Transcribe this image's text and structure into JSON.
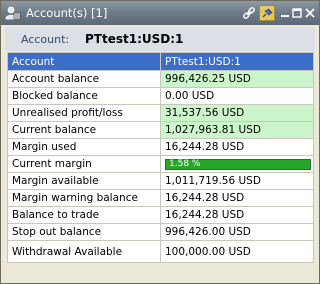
{
  "window": {
    "title": "Account(s) [1]",
    "icons": [
      "account-icon",
      "link-icon",
      "pin-icon",
      "minimize-icon",
      "maximize-icon",
      "close-icon"
    ]
  },
  "account": {
    "label": "Account:",
    "value": "PTtest1:USD:1"
  },
  "grid": {
    "header": {
      "label": "Account",
      "value": "PTtest1:USD:1"
    },
    "rows": [
      {
        "label": "Account balance",
        "value": "996,426.25 USD",
        "highlight": true
      },
      {
        "label": "Blocked balance",
        "value": "0.00 USD",
        "highlight": false
      },
      {
        "label": "Unrealised profit/loss",
        "value": "31,537.56 USD",
        "highlight": true
      },
      {
        "label": "Current balance",
        "value": "1,027,963.81 USD",
        "highlight": true
      },
      {
        "label": "Margin used",
        "value": "16,244.28 USD",
        "highlight": false
      },
      {
        "label": "Current margin",
        "value": "1.58 %",
        "progress": 1.58
      },
      {
        "label": "Margin available",
        "value": "1,011,719.56 USD",
        "highlight": false
      },
      {
        "label": "Margin warning balance",
        "value": "16,244.28 USD",
        "highlight": false
      },
      {
        "label": "Balance to trade",
        "value": "16,244.28 USD",
        "highlight": false
      },
      {
        "label": "Stop out balance",
        "value": "996,426.00 USD",
        "highlight": false
      },
      {
        "label": "Withdrawal Available",
        "value": "100,000.00 USD",
        "highlight": false
      }
    ]
  },
  "colors": {
    "header_bg": "#3b6ec8",
    "highlight_bg": "#ccf5cc",
    "progress_fill": "#29a629"
  }
}
